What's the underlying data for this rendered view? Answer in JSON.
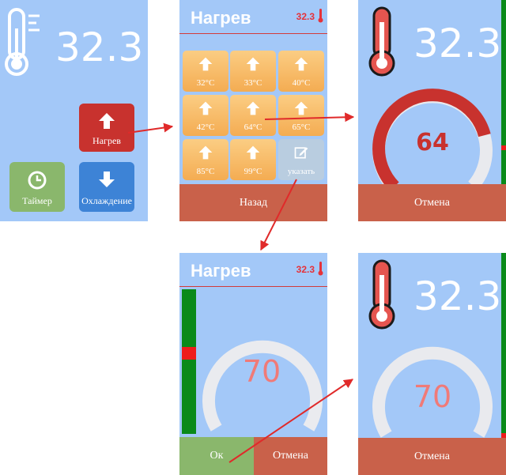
{
  "colors": {
    "panel_bg": "#a3c8f8",
    "heat_red": "#c8322e",
    "tile_orange": "#f6b862",
    "timer_green": "#8ab76c",
    "cool_blue": "#3d83d6",
    "bar_red": "#c9614a",
    "ok_green": "#8ab76c",
    "indicator_green": "#0a8a1a",
    "indicator_red": "#ee1c1c"
  },
  "main_screen": {
    "temperature": "32.3",
    "thermometer_icon": "thermometer-icon",
    "heat_button": {
      "label": "Нагрев",
      "icon": "arrow-up-icon"
    },
    "timer_button": {
      "label": "Таймер",
      "icon": "clock-icon"
    },
    "cool_button": {
      "label": "Охлаждение",
      "icon": "arrow-down-icon"
    }
  },
  "preset_screen": {
    "title": "Нагрев",
    "temperature": "32.3",
    "presets": [
      {
        "label": "32°C"
      },
      {
        "label": "33°C"
      },
      {
        "label": "40°C"
      },
      {
        "label": "42°C"
      },
      {
        "label": "64°C"
      },
      {
        "label": "65°C"
      },
      {
        "label": "85°C"
      },
      {
        "label": "99°C"
      }
    ],
    "custom_tile": {
      "label": "указать",
      "icon": "pencil-edit-icon"
    },
    "back_button": "Назад"
  },
  "heating_screen": {
    "temperature": "32.3",
    "target": "64",
    "progress": 0.78,
    "cancel_button": "Отмена"
  },
  "custom_screen": {
    "title": "Нагрев",
    "temperature": "32.3",
    "target": "70",
    "slider_level": 0.56,
    "ok_button": "Ок",
    "cancel_button": "Отмена"
  },
  "heating_screen_2": {
    "temperature": "32.3",
    "target": "70",
    "progress": 0.0,
    "cancel_button": "Отмена"
  }
}
